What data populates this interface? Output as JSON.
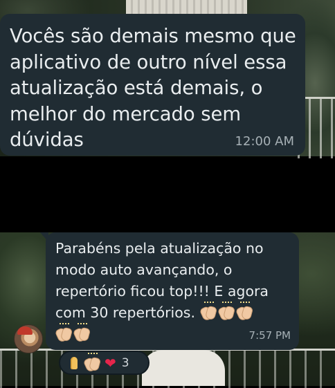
{
  "messages": [
    {
      "text": "Vocês são demais mesmo que aplicativo de outro nível essa atualização está demais, o melhor do mercado sem dúvidas",
      "time": "12:00 AM"
    },
    {
      "text": "Parabéns pela atualização no modo auto avançando, o repertório ficou top!!! E agora com 30 repertórios.",
      "time": "7:57 PM",
      "emoji": [
        "clapping-hands",
        "clapping-hands",
        "clapping-hands",
        "clapping-hands",
        "clapping-hands"
      ],
      "reactions": {
        "icons": [
          "folded-hands",
          "clapping-hands",
          "red-heart"
        ],
        "count": "3"
      }
    }
  ],
  "colors": {
    "bubble": "#202c33",
    "text": "#e9edef",
    "timestamp": "#a7b1b6",
    "heart": "#e6254b"
  }
}
